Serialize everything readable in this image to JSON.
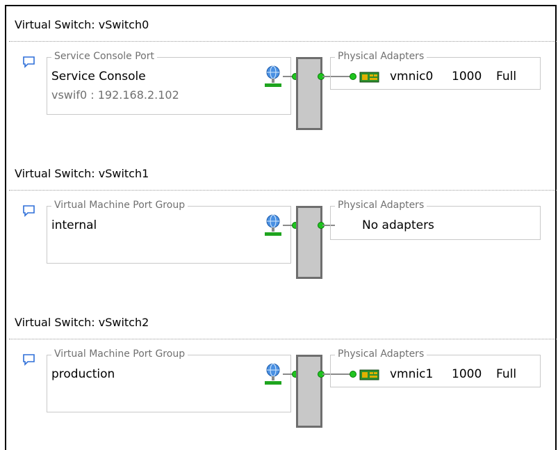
{
  "switches": [
    {
      "title": "Virtual Switch: vSwitch0",
      "port_group_type": "Service Console Port",
      "port_group_name": "Service Console",
      "port_group_detail": "vswif0 : 192.168.2.102",
      "adapters_label": "Physical Adapters",
      "adapter": {
        "name": "vmnic0",
        "speed": "1000",
        "duplex": "Full"
      }
    },
    {
      "title": "Virtual Switch: vSwitch1",
      "port_group_type": "Virtual Machine Port Group",
      "port_group_name": "internal",
      "adapters_label": "Physical Adapters",
      "no_adapters": "No adapters"
    },
    {
      "title": "Virtual Switch: vSwitch2",
      "port_group_type": "Virtual Machine Port Group",
      "port_group_name": "production",
      "adapters_label": "Physical Adapters",
      "adapter": {
        "name": "vmnic1",
        "speed": "1000",
        "duplex": "Full"
      }
    }
  ],
  "icons": {
    "properties": "speech-bubble-icon",
    "port_group": "globe-network-icon",
    "adapter": "network-card-icon"
  },
  "colors": {
    "link_dot": "#1fc41f",
    "switch_fill": "#c8c8c8",
    "bubble_blue": "#2e6fd8"
  }
}
